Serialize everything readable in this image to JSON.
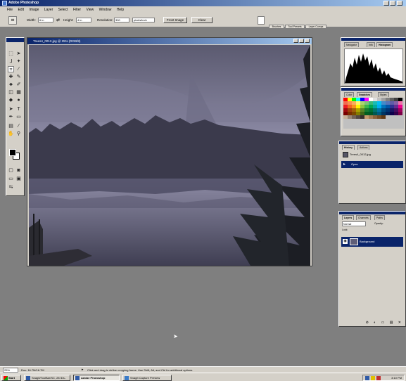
{
  "app": {
    "title": "Adobe Photoshop"
  },
  "menu": [
    "File",
    "Edit",
    "Image",
    "Layer",
    "Select",
    "Filter",
    "View",
    "Window",
    "Help"
  ],
  "options": {
    "width_label": "Width:",
    "width_value": "6 in",
    "height_label": "Height:",
    "height_value": "4 in",
    "resolution_label": "Resolution:",
    "resolution_value": "300",
    "resolution_unit": "pixels/inch",
    "front_image": "Front Image",
    "clear": "Clear",
    "well_tabs": [
      "Brushes",
      "Tool Presets",
      "Layer Comps"
    ]
  },
  "document": {
    "title": "Trees4_0012.jpg @ 25% (RGB/8)"
  },
  "panels": {
    "navigator": {
      "tabs": [
        "Navigator",
        "Info",
        "Histogram"
      ]
    },
    "color": {
      "tabs": [
        "Color",
        "Swatches",
        "Styles"
      ]
    },
    "history": {
      "tabs": [
        "History",
        "Actions"
      ],
      "items": [
        "Trees4_0012.jpg",
        "Open"
      ]
    },
    "layers": {
      "tabs": [
        "Layers",
        "Channels",
        "Paths"
      ],
      "blend_mode": "Normal",
      "opacity_label": "Opacity:",
      "lock_label": "Lock:",
      "layer_name": "Background"
    }
  },
  "status": {
    "zoom": "25%",
    "doc": "Doc: 16.7M/16.7M",
    "hint": "Click and drag to define cropping frame. Use Shift, Alt, and Ctrl for additional options."
  },
  "taskbar": {
    "start": "Start",
    "tasks": [
      "SnagIt/ToolBar/SC, 28 IDs..",
      "Adobe Photoshop",
      "SnagIt Capture Preview"
    ],
    "clock": "3:10 PM"
  },
  "colors": {
    "titlebar": "#0a246a",
    "chrome": "#d4d0c8",
    "workspace": "#7f7f7f"
  }
}
